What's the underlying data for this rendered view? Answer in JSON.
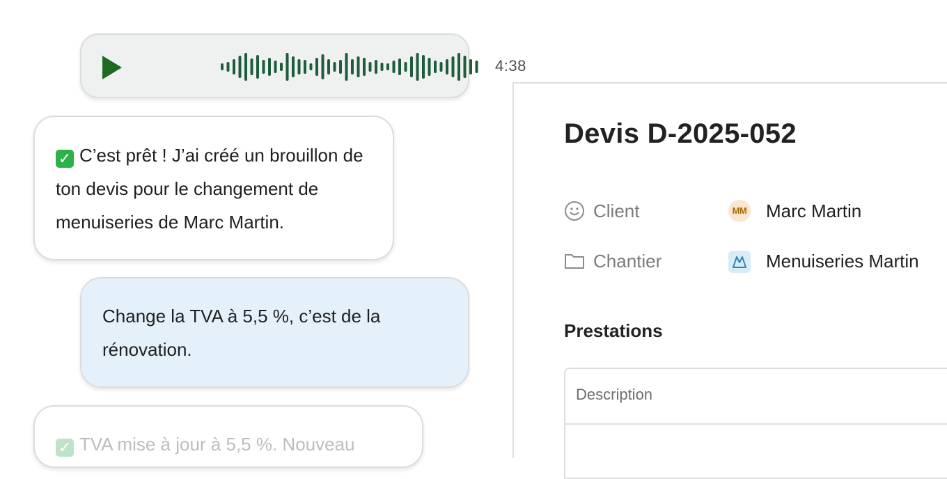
{
  "voice_message": {
    "duration": "4:38",
    "waveform_levels": [
      0.25,
      0.35,
      0.55,
      0.8,
      1.0,
      0.6,
      0.85,
      0.5,
      0.65,
      0.45,
      0.3,
      1.0,
      0.75,
      0.55,
      0.5,
      0.25,
      0.65,
      0.9,
      0.55,
      0.35,
      0.5,
      1.0,
      0.55,
      0.75,
      0.65,
      0.35,
      0.5,
      0.3,
      0.25,
      0.45,
      0.6,
      0.35,
      0.75,
      1.0,
      0.85,
      0.65,
      0.45,
      0.35,
      0.55,
      0.75,
      1.0,
      0.8,
      0.55,
      0.45
    ],
    "colors": {
      "wave": "#1f5c3c",
      "play": "#1d6a22"
    }
  },
  "messages": [
    {
      "role": "assistant",
      "icon": "check-icon",
      "text": "C’est prêt ! J’ai créé un brouillon de ton devis pour le changement de menuiseries de Marc Martin."
    },
    {
      "role": "user",
      "text": "Change la TVA à 5,5 %, c’est de la rénovation."
    },
    {
      "role": "assistant",
      "icon": "check-icon",
      "text": "TVA mise à jour à 5,5 %. Nouveau"
    }
  ],
  "document": {
    "title": "Devis D-2025-052",
    "fields": [
      {
        "icon": "smiley-icon",
        "label": "Client",
        "value_icon": "avatar",
        "avatar_initials": "MM",
        "value": "Marc Martin"
      },
      {
        "icon": "folder-icon",
        "label": "Chantier",
        "value_icon": "site-icon",
        "value": "Menuiseries Martin"
      }
    ],
    "section_title": "Prestations",
    "table_header": "Description"
  }
}
